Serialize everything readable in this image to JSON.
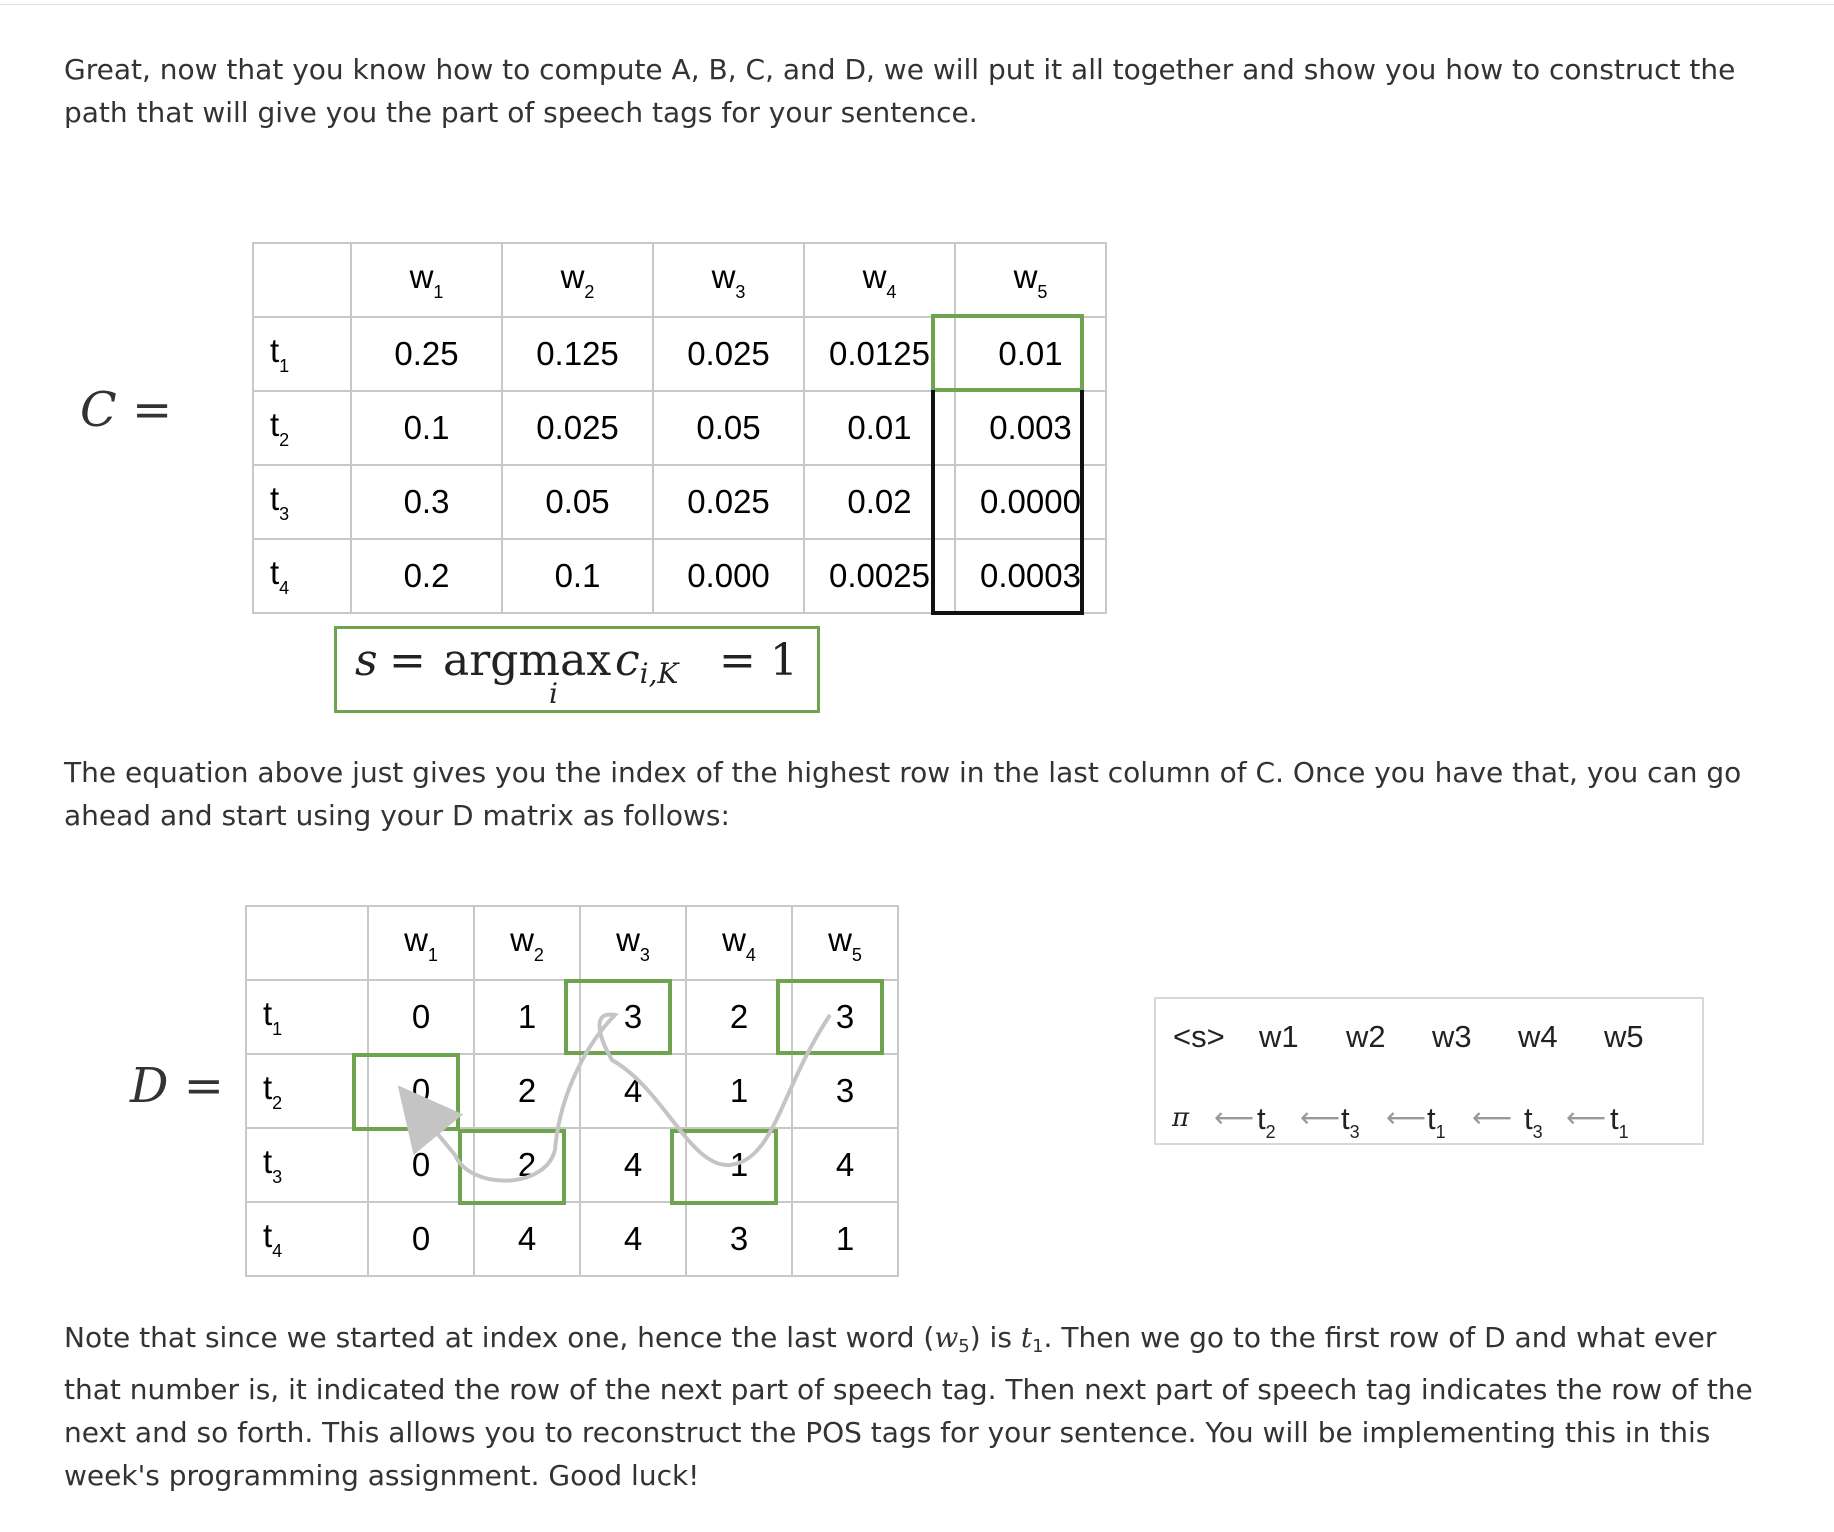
{
  "intro_text": "Great, now that you know how to compute A, B, C, and D, we will put it all together and show you how to construct the path that will give you the part of speech tags for your sentence.",
  "c_label": "C",
  "c_matrix": {
    "columns": [
      [
        "w",
        "1"
      ],
      [
        "w",
        "2"
      ],
      [
        "w",
        "3"
      ],
      [
        "w",
        "4"
      ],
      [
        "w",
        "5"
      ]
    ],
    "rows": [
      {
        "tag": [
          "t",
          "1"
        ],
        "values": [
          "0.25",
          "0.125",
          "0.025",
          "0.0125",
          "0.01"
        ]
      },
      {
        "tag": [
          "t",
          "2"
        ],
        "values": [
          "0.1",
          "0.025",
          "0.05",
          "0.01",
          "0.003"
        ]
      },
      {
        "tag": [
          "t",
          "3"
        ],
        "values": [
          "0.3",
          "0.05",
          "0.025",
          "0.02",
          "0.0000"
        ]
      },
      {
        "tag": [
          "t",
          "4"
        ],
        "values": [
          "0.2",
          "0.1",
          "0.000",
          "0.0025",
          "0.0003"
        ]
      }
    ]
  },
  "argmax_equation": {
    "lhs": "s",
    "operator": "argmax",
    "under": "i",
    "term": "c",
    "term_sub": "i,K",
    "result": "1"
  },
  "middle_text": "The equation above just gives you the index of the highest row in the last column of C. Once you have that, you can go ahead and start using your D matrix as follows:",
  "d_label": "D",
  "d_matrix": {
    "columns": [
      [
        "w",
        "1"
      ],
      [
        "w",
        "2"
      ],
      [
        "w",
        "3"
      ],
      [
        "w",
        "4"
      ],
      [
        "w",
        "5"
      ]
    ],
    "rows": [
      {
        "tag": [
          "t",
          "1"
        ],
        "values": [
          "0",
          "1",
          "3",
          "2",
          "3"
        ]
      },
      {
        "tag": [
          "t",
          "2"
        ],
        "values": [
          "0",
          "2",
          "4",
          "1",
          "3"
        ]
      },
      {
        "tag": [
          "t",
          "3"
        ],
        "values": [
          "0",
          "2",
          "4",
          "1",
          "4"
        ]
      },
      {
        "tag": [
          "t",
          "4"
        ],
        "values": [
          "0",
          "4",
          "4",
          "3",
          "1"
        ]
      }
    ]
  },
  "path_panel": {
    "words": [
      "<s>",
      "w1",
      "w2",
      "w3",
      "w4",
      "w5"
    ],
    "pi": "π",
    "tags": [
      [
        "t",
        "2"
      ],
      [
        "t",
        "3"
      ],
      [
        "t",
        "1"
      ],
      [
        "t",
        "3"
      ],
      [
        "t",
        "1"
      ]
    ]
  },
  "note": {
    "part1": "Note that since we started at index one, hence the last word (",
    "w5": "w",
    "w5_sub": "5",
    "part2": ") is ",
    "t1": "t",
    "t1_sub": "1",
    "part3": ". Then we go to the first row of D and what ever that number is, it indicated the row of the next part of speech tag. Then next part of speech tag indicates the row of the next and so forth. This allows you to reconstruct the POS tags for your sentence. You will be implementing this in this week's programming assignment. Good luck!"
  },
  "colors": {
    "highlight": "#6fa350",
    "grid": "#c8c8c8",
    "curve": "#c4c4c4",
    "text": "#333333"
  }
}
